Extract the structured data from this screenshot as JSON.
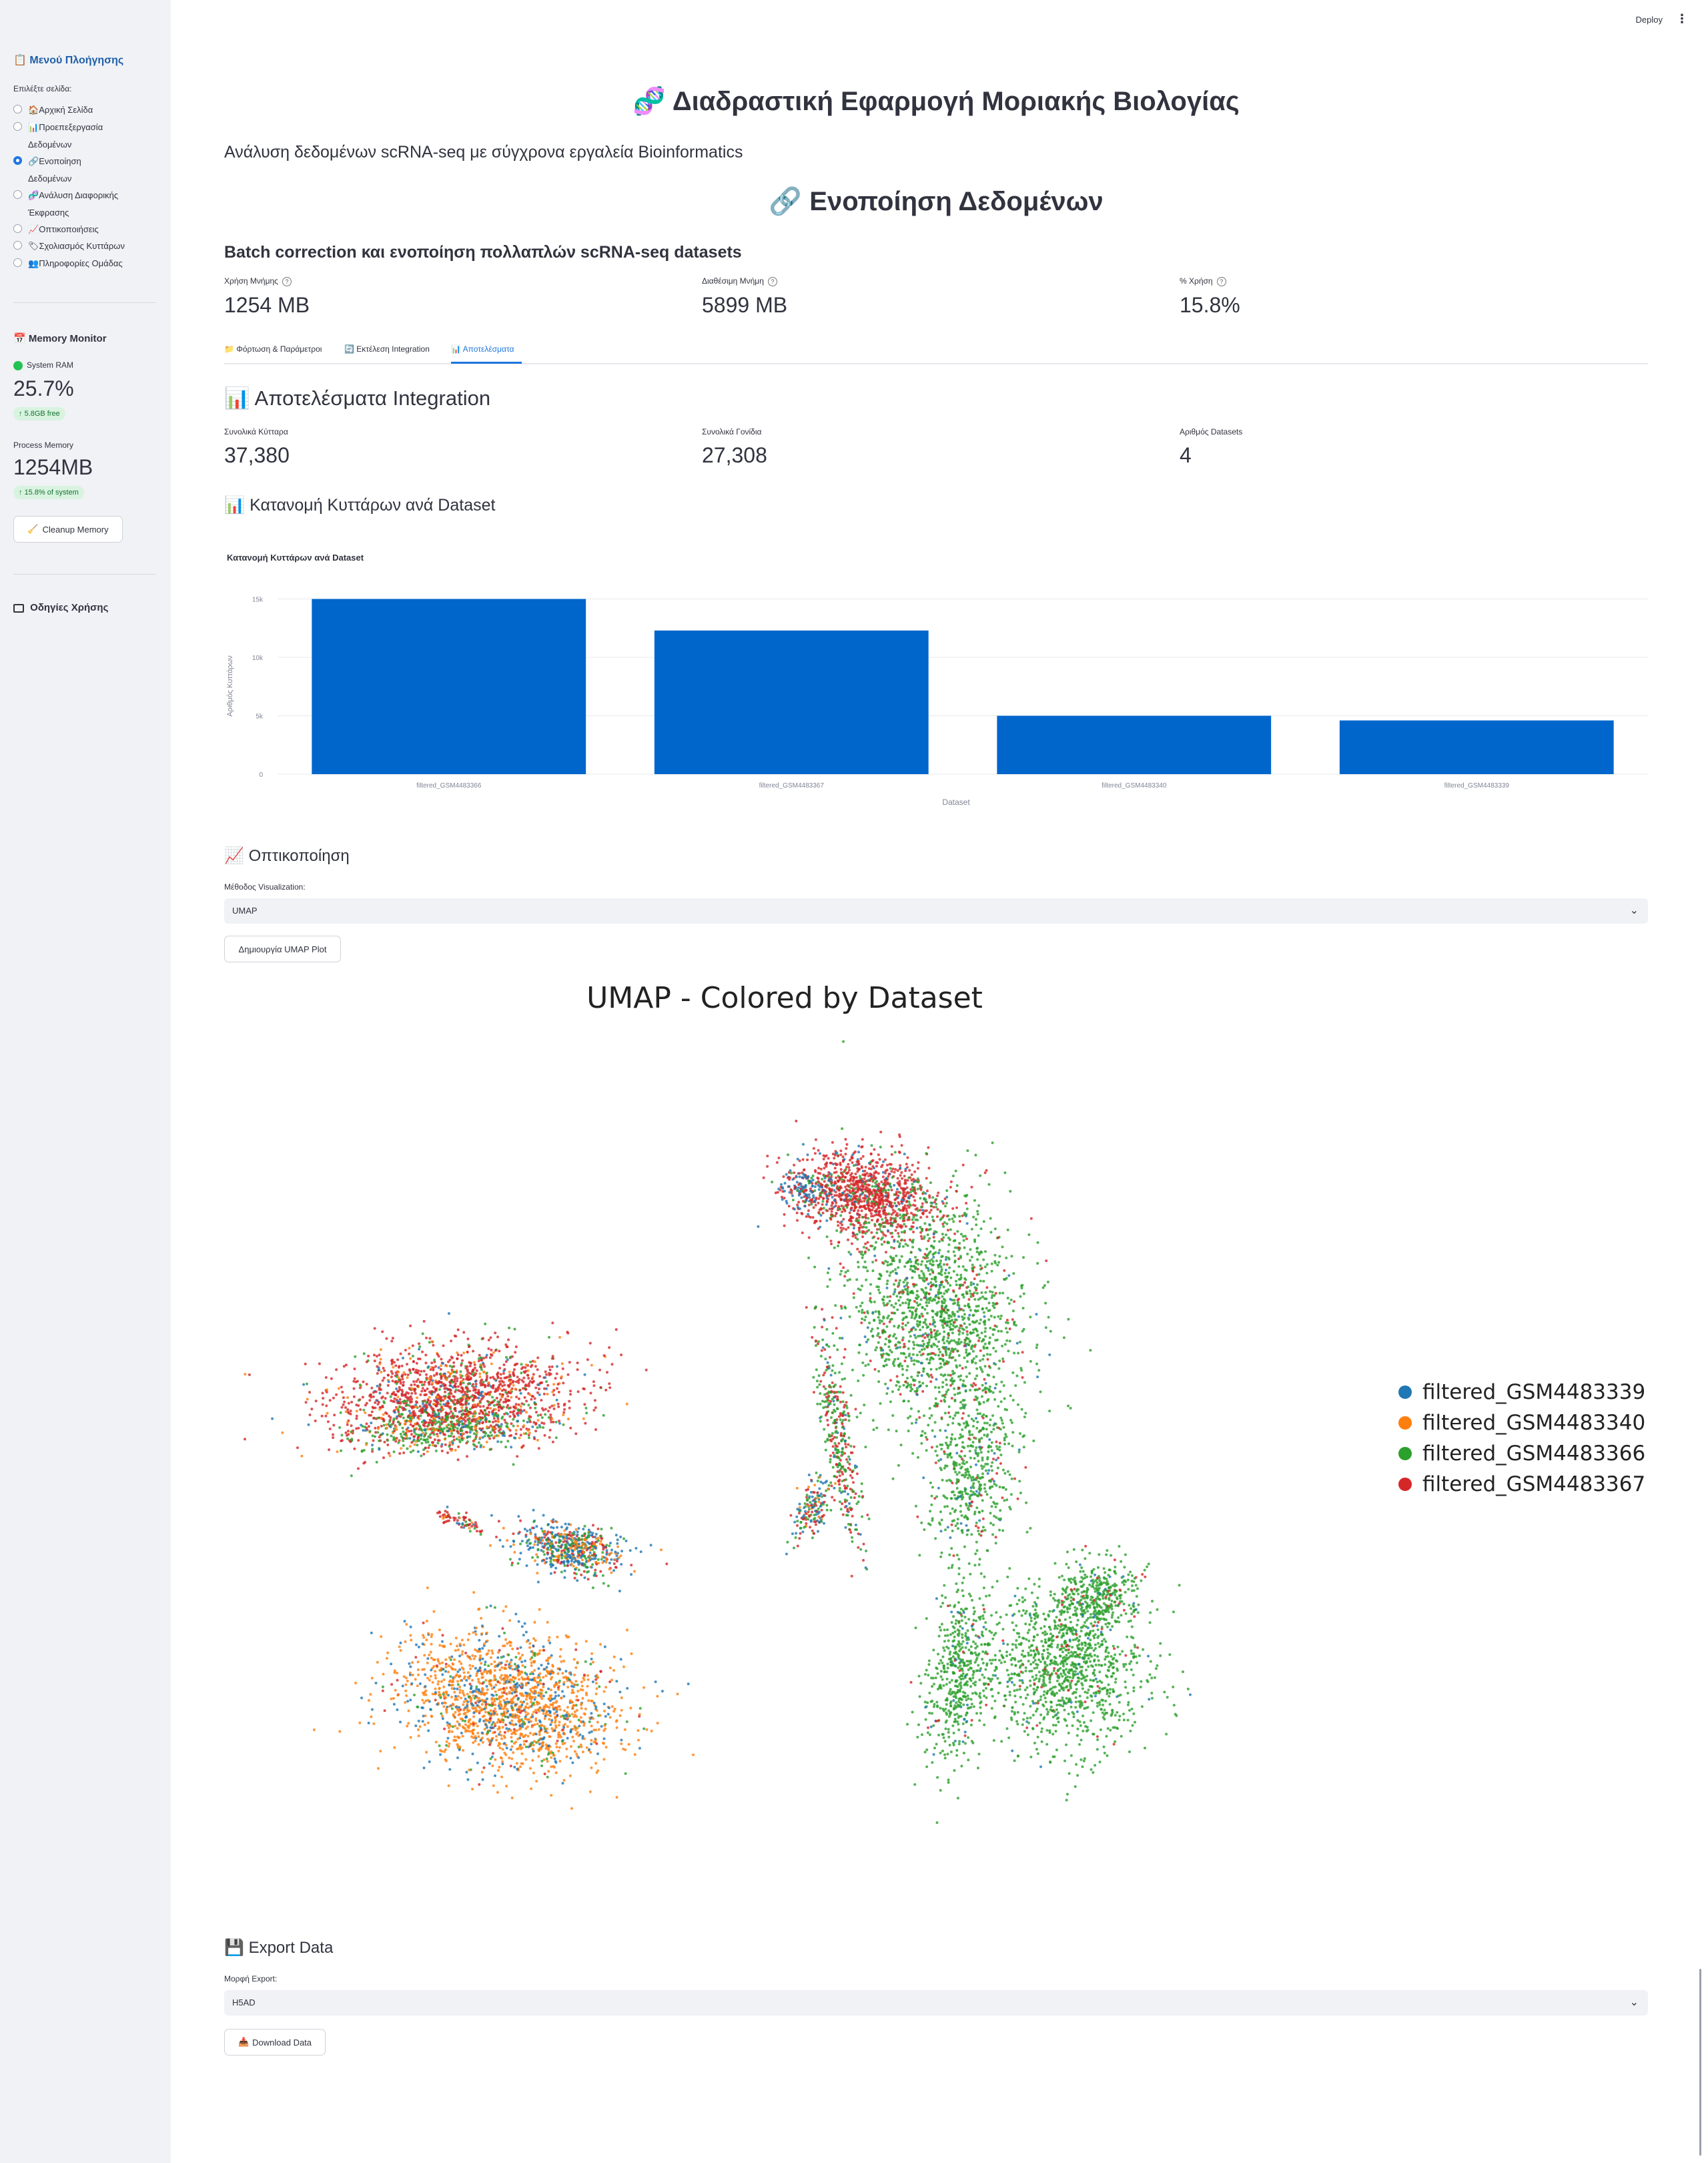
{
  "toolbar": {
    "deploy_label": "Deploy",
    "menu_icon": "⋮"
  },
  "sidebar": {
    "nav_title": "Μενού Πλοήγησης",
    "select_label": "Επιλέξτε σελίδα:",
    "items": [
      {
        "icon": "🏠",
        "label": "Αρχική Σελίδα",
        "line2": ""
      },
      {
        "icon": "📊",
        "label": "Προεπεξεργασία",
        "line2": "Δεδομένων"
      },
      {
        "icon": "🔗",
        "label": "Ενοποίηση",
        "line2": "Δεδομένων"
      },
      {
        "icon": "🧬",
        "label": "Ανάλυση Διαφορικής",
        "line2": "Έκφρασης"
      },
      {
        "icon": "📈",
        "label": "Οπτικοποιήσεις",
        "line2": ""
      },
      {
        "icon": "🏷",
        "label": "Σχολιασμός Κυττάρων",
        "line2": ""
      },
      {
        "icon": "👥",
        "label": "Πληροφορίες Ομάδας",
        "line2": ""
      }
    ],
    "selected_index": 2,
    "memory": {
      "title": "Memory Monitor",
      "system_label": "System RAM",
      "system_value": "25.7%",
      "system_delta": "5.8GB free",
      "process_label": "Process Memory",
      "process_value": "1254MB",
      "process_delta": "15.8% of system",
      "cleanup_label": "Cleanup Memory"
    },
    "guide_title": "Οδηγίες Χρήσης"
  },
  "header": {
    "app_title": "Διαδραστική Εφαρμογή Μοριακής Βιολογίας",
    "subtitle": "Ανάλυση δεδομένων scRNA-seq με σύγχρονα εργαλεία Bioinformatics",
    "page_title": "Ενοποίηση Δεδομένων",
    "page_subtitle": "Batch correction και ενοποίηση πολλαπλών scRNA-seq datasets"
  },
  "top_metrics": [
    {
      "label": "Χρήση Μνήμης",
      "value": "1254 MB"
    },
    {
      "label": "Διαθέσιμη Μνήμη",
      "value": "5899 MB"
    },
    {
      "label": "% Χρήση",
      "value": "15.8%"
    }
  ],
  "tabs": [
    {
      "icon": "📁",
      "label": "Φόρτωση & Παράμετροι"
    },
    {
      "icon": "🔄",
      "label": "Εκτέλεση Integration"
    },
    {
      "icon": "📊",
      "label": "Αποτελέσματα"
    }
  ],
  "active_tab": 2,
  "results": {
    "title": "Αποτελέσματα Integration",
    "metrics": [
      {
        "label": "Συνολικά Κύτταρα",
        "value": "37,380"
      },
      {
        "label": "Συνολικά Γονίδια",
        "value": "27,308"
      },
      {
        "label": "Αριθμός Datasets",
        "value": "4"
      }
    ],
    "dist_title": "Κατανομή Κυττάρων ανά Dataset"
  },
  "viz": {
    "title": "Οπτικοποίηση",
    "method_label": "Μέθοδος Visualization:",
    "method_value": "UMAP",
    "button_label": "Δημιουργία UMAP Plot"
  },
  "export": {
    "title": "Export Data",
    "format_label": "Μορφή Export:",
    "format_value": "H5AD",
    "download_label": "Download Data"
  },
  "chart_data": [
    {
      "type": "bar",
      "title": "Κατανομή Κυττάρων ανά Dataset",
      "xlabel": "Dataset",
      "ylabel": "Αριθμός Κυττάρων",
      "categories": [
        "filtered_GSM4483366",
        "filtered_GSM4483367",
        "filtered_GSM4483340",
        "filtered_GSM4483339"
      ],
      "values": [
        15000,
        12300,
        5000,
        4600
      ],
      "ylim": [
        0,
        16000
      ],
      "yticks": [
        0,
        5000,
        10000,
        15000
      ],
      "ytick_labels": [
        "0",
        "5k",
        "10k",
        "15k"
      ],
      "color": "#0066cc",
      "grid": true
    },
    {
      "type": "scatter",
      "title": "UMAP - Colored by Dataset",
      "legend_position": "right",
      "series": [
        {
          "name": "filtered_GSM4483339",
          "color": "#1f77b4"
        },
        {
          "name": "filtered_GSM4483340",
          "color": "#ff7f0e"
        },
        {
          "name": "filtered_GSM4483366",
          "color": "#2ca02c"
        },
        {
          "name": "filtered_GSM4483367",
          "color": "#d62728"
        }
      ],
      "axes": "hidden"
    }
  ]
}
